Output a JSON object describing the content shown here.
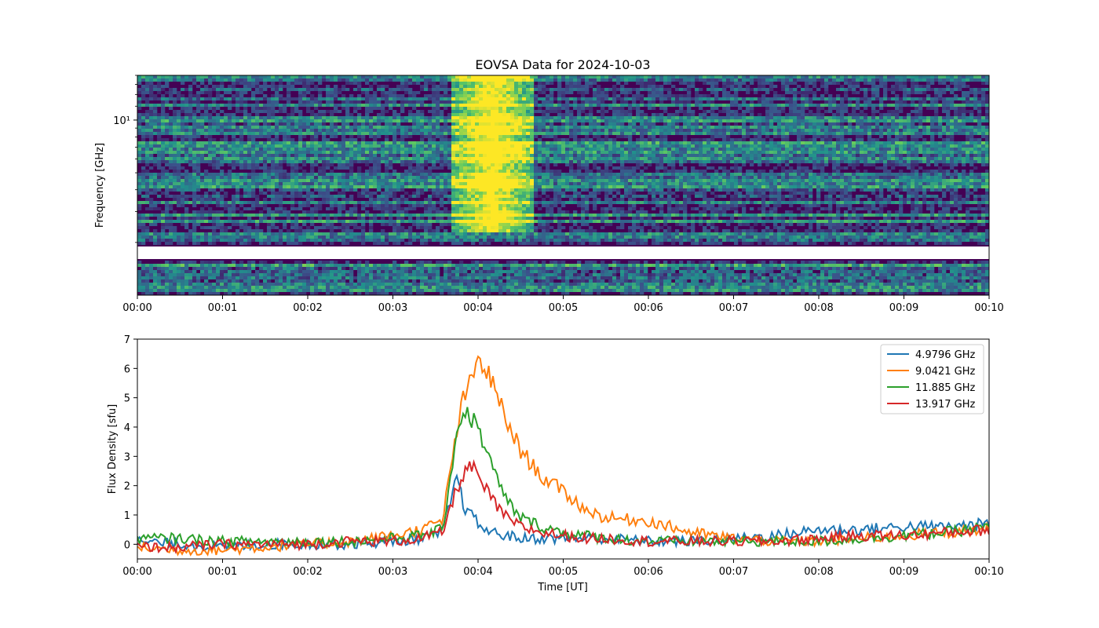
{
  "figure_title": "EOVSA Data for 2024-10-03",
  "chart_data": [
    {
      "type": "heatmap",
      "title": "EOVSA Data for 2024-10-03",
      "xlabel": "",
      "ylabel": "Frequency [GHz]",
      "yscale": "log",
      "y_tick_labels": [
        {
          "value": 10,
          "label": "10¹"
        }
      ],
      "ylim": [
        1.0,
        18.0
      ],
      "x_tick_labels": [
        "00:00",
        "00:01",
        "00:02",
        "00:03",
        "00:04",
        "00:05",
        "00:06",
        "00:07",
        "00:08",
        "00:09",
        "00:10"
      ],
      "xlim": [
        "00:00",
        "00:10"
      ],
      "colormap": "viridis",
      "notes": "Bright burst near 00:03:40–00:04:40 across higher frequencies; no-data gap band near 2.0–2.4 GHz",
      "burst_window": [
        "00:03:40",
        "00:04:40"
      ],
      "gap_band_ghz": [
        2.0,
        2.35
      ]
    },
    {
      "type": "line",
      "title": "",
      "xlabel": "Time [UT]",
      "ylabel": "Flux Density [sfu]",
      "ylim": [
        -0.5,
        7
      ],
      "y_ticks": [
        0,
        1,
        2,
        3,
        4,
        5,
        6,
        7
      ],
      "x_tick_labels": [
        "00:00",
        "00:01",
        "00:02",
        "00:03",
        "00:04",
        "00:05",
        "00:06",
        "00:07",
        "00:08",
        "00:09",
        "00:10"
      ],
      "xlim": [
        "00:00",
        "00:10"
      ],
      "legend_position": "top-right",
      "x": [
        "00:00",
        "00:00:30",
        "00:01",
        "00:01:30",
        "00:02",
        "00:02:30",
        "00:03",
        "00:03:20",
        "00:03:35",
        "00:03:45",
        "00:03:50",
        "00:03:55",
        "00:04",
        "00:04:05",
        "00:04:10",
        "00:04:20",
        "00:04:30",
        "00:04:45",
        "00:05",
        "00:05:15",
        "00:05:30",
        "00:06",
        "00:06:30",
        "00:07",
        "00:07:30",
        "00:08",
        "00:08:30",
        "00:09",
        "00:09:30",
        "00:10"
      ],
      "series": [
        {
          "name": "4.9796 GHz",
          "color": "#1f77b4",
          "values": [
            0.1,
            0.0,
            -0.1,
            0.0,
            0.0,
            0.0,
            0.1,
            0.2,
            0.4,
            2.3,
            1.3,
            1.0,
            0.7,
            0.5,
            0.4,
            0.3,
            0.2,
            0.2,
            0.2,
            0.2,
            0.2,
            0.1,
            0.1,
            0.2,
            0.3,
            0.5,
            0.5,
            0.6,
            0.6,
            0.7
          ]
        },
        {
          "name": "9.0421 GHz",
          "color": "#ff7f0e",
          "values": [
            -0.1,
            -0.2,
            -0.2,
            -0.1,
            0.0,
            0.1,
            0.3,
            0.5,
            0.8,
            3.9,
            5.0,
            5.5,
            6.3,
            6.0,
            5.5,
            4.2,
            3.2,
            2.3,
            1.8,
            1.2,
            0.9,
            0.8,
            0.4,
            0.2,
            0.1,
            0.1,
            0.2,
            0.3,
            0.4,
            0.5
          ]
        },
        {
          "name": "11.885 GHz",
          "color": "#2ca02c",
          "values": [
            0.2,
            0.2,
            0.1,
            0.1,
            0.1,
            0.1,
            0.2,
            0.3,
            0.5,
            3.8,
            4.6,
            4.3,
            4.0,
            3.3,
            2.6,
            1.5,
            0.9,
            0.6,
            0.4,
            0.3,
            0.2,
            0.1,
            0.1,
            0.1,
            0.1,
            0.1,
            0.2,
            0.3,
            0.4,
            0.6
          ]
        },
        {
          "name": "13.917 GHz",
          "color": "#d62728",
          "values": [
            -0.1,
            -0.1,
            0.0,
            0.0,
            0.0,
            0.1,
            0.1,
            0.2,
            0.4,
            1.9,
            2.4,
            2.7,
            2.3,
            1.9,
            1.5,
            0.9,
            0.6,
            0.4,
            0.3,
            0.2,
            0.2,
            0.1,
            0.1,
            0.1,
            0.1,
            0.2,
            0.3,
            0.3,
            0.4,
            0.5
          ]
        }
      ]
    }
  ]
}
